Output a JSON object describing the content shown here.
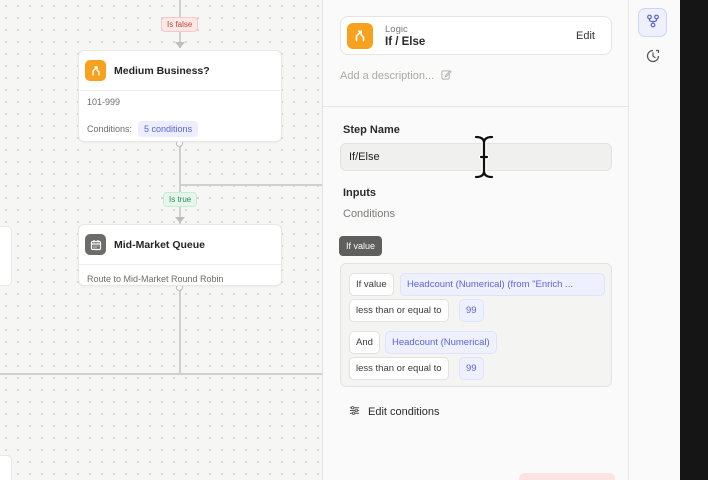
{
  "canvas": {
    "branch_false": "Is false",
    "branch_true": "Is true",
    "node_medium": {
      "title": "Medium Business?",
      "range": "101-999",
      "conditions_label": "Conditions:",
      "conditions_count": "5 conditions",
      "icon": "logic-branch-icon"
    },
    "node_queue": {
      "title": "Mid-Market Queue",
      "subtitle": "Route to Mid-Market Round Robin",
      "icon": "calendar-icon"
    }
  },
  "panel": {
    "logic": {
      "kind": "Logic",
      "name": "If / Else",
      "edit": "Edit"
    },
    "description_placeholder": "Add a description...",
    "step_name_label": "Step Name",
    "step_name_value": "If/Else",
    "inputs_label": "Inputs",
    "conditions_label": "Conditions",
    "if_value_tag": "If value",
    "condition_rows": [
      {
        "op": "If value",
        "field": "Headcount (Numerical) (from \"Enrich ...",
        "comparator": "less than or equal to",
        "value": "99"
      },
      {
        "op": "And",
        "field": "Headcount (Numerical)",
        "comparator": "less than or equal to",
        "value": "99"
      }
    ],
    "edit_conditions": "Edit conditions"
  },
  "colors": {
    "accent": "#5d64d8",
    "logic_orange": "#f6a21e",
    "true_green": "#2f8a51",
    "false_red": "#c0473b"
  }
}
